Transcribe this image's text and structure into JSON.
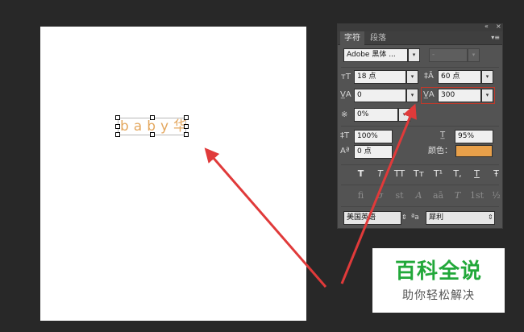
{
  "canvas": {
    "text_layer": "baby华"
  },
  "panel": {
    "tabs": [
      {
        "label": "字符",
        "active": true
      },
      {
        "label": "段落",
        "active": false
      }
    ],
    "font_family": "Adobe 黑体 ...",
    "font_style": "-",
    "font_size": "18 点",
    "leading": "60 点",
    "kerning": "0",
    "tracking": "300",
    "tsume": "0%",
    "vertical_scale": "100%",
    "horizontal_scale": "95%",
    "baseline_shift": "0 点",
    "color_label": "颜色：",
    "color_value": "#e8a04a",
    "style_buttons": [
      "T",
      "T",
      "TT",
      "Tт",
      "T¹",
      "T,",
      "T",
      "Ŧ"
    ],
    "opentype_buttons": [
      "fi",
      "σ",
      "st",
      "A",
      "aā",
      "T",
      "1st",
      "½"
    ],
    "language": "美国英语",
    "aa_icon_label": "ªa",
    "antialias": "犀利"
  },
  "watermark": {
    "title": "百科全说",
    "subtitle": "助你轻松解决"
  },
  "colors": {
    "highlight": "#c0392b",
    "arrow": "#e03a3a",
    "text_color": "#e4a860"
  }
}
